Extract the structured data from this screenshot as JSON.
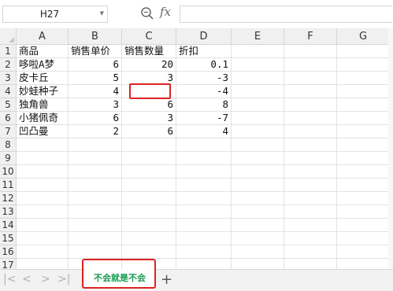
{
  "formula_bar": {
    "cell_ref": "H27",
    "fx_label": "fx",
    "formula": ""
  },
  "columns": [
    "A",
    "B",
    "C",
    "D",
    "E",
    "F",
    "G"
  ],
  "rows": [
    "1",
    "2",
    "3",
    "4",
    "5",
    "6",
    "7",
    "8",
    "9",
    "10",
    "11",
    "12",
    "13",
    "14",
    "15",
    "16",
    "17"
  ],
  "headers": {
    "A": "商品",
    "B": "销售单价",
    "C": "销售数量",
    "D": "折扣"
  },
  "data_rows": [
    {
      "name": "哆啦A梦",
      "price": "6",
      "qty": "20",
      "discount": "0.1"
    },
    {
      "name": "皮卡丘",
      "price": "5",
      "qty": "3",
      "discount": "-3"
    },
    {
      "name": "妙蛙种子",
      "price": "4",
      "qty": "",
      "discount": "-4"
    },
    {
      "name": "独角兽",
      "price": "3",
      "qty": "6",
      "discount": "8"
    },
    {
      "name": "小猪佩奇",
      "price": "6",
      "qty": "3",
      "discount": "-7"
    },
    {
      "name": "凹凸曼",
      "price": "2",
      "qty": "6",
      "discount": "4"
    }
  ],
  "sheet_tabs": [
    {
      "label": "不会就是不会",
      "active": true
    }
  ],
  "tab_nav": {
    "first": "|<",
    "prev": "<",
    "next": ">",
    "last": ">|",
    "add": "+"
  },
  "colors": {
    "accent_tab": "#1a9b50",
    "highlight_border": "#dd2222"
  }
}
